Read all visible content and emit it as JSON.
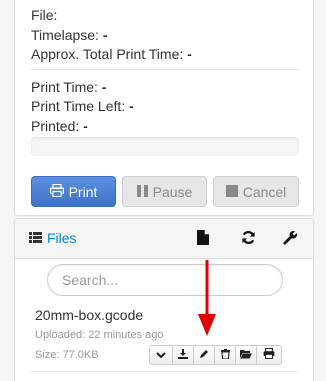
{
  "state": {
    "file_label": "File:",
    "timelapse_label": "Timelapse:",
    "timelapse_value": "-",
    "approx_label": "Approx. Total Print Time:",
    "approx_value": "-",
    "print_time_label": "Print Time:",
    "print_time_value": "-",
    "print_time_left_label": "Print Time Left:",
    "print_time_left_value": "-",
    "printed_label": "Printed:",
    "printed_value": "-",
    "progress_fraction": 0
  },
  "controls": {
    "print_label": "Print",
    "pause_label": "Pause",
    "cancel_label": "Cancel"
  },
  "files": {
    "title": "Files",
    "search_placeholder": "Search...",
    "items": [
      {
        "name": "20mm-box.gcode",
        "uploaded": "Uploaded: 22 minutes ago",
        "size": "Size: 77.0KB"
      }
    ],
    "action_icons": [
      "chevron-down-icon",
      "download-icon",
      "pencil-icon",
      "trash-icon",
      "folder-open-icon",
      "print-icon"
    ]
  },
  "annotation": {
    "arrow_color": "#e00000",
    "arrow_target": "pencil-icon"
  }
}
